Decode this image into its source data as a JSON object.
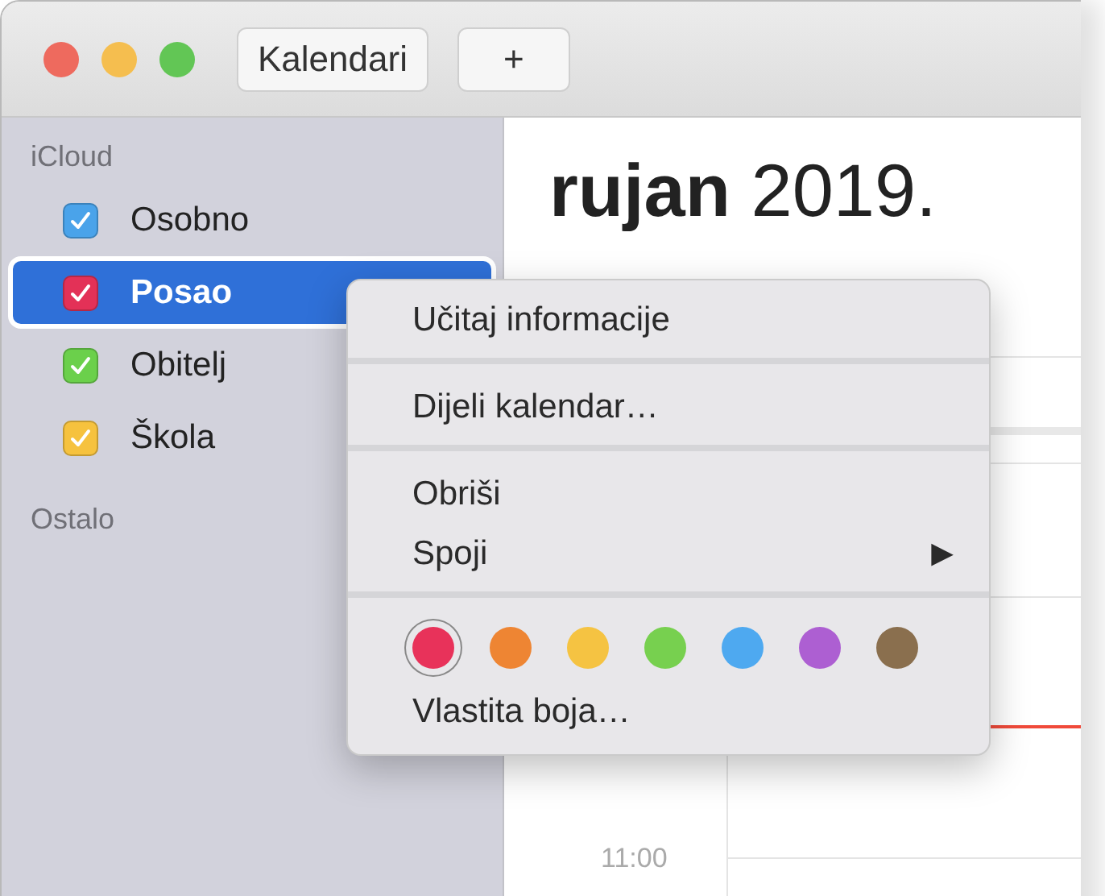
{
  "toolbar": {
    "buttons": [
      "Kalendari",
      "+"
    ]
  },
  "sidebar": {
    "groups": [
      {
        "title": "iCloud",
        "calendars": [
          {
            "name": "Osobno",
            "checked": true,
            "selected": false,
            "color": "#4aa3ea"
          },
          {
            "name": "Posao",
            "checked": true,
            "selected": true,
            "color": "#e33157"
          },
          {
            "name": "Obitelj",
            "checked": true,
            "selected": false,
            "color": "#6bd04b"
          },
          {
            "name": "Škola",
            "checked": true,
            "selected": false,
            "color": "#f6c23e"
          }
        ]
      },
      {
        "title": "Ostalo"
      }
    ]
  },
  "main": {
    "title": "**rujan** 2019.",
    "time_label": "11:00"
  },
  "context_menu": {
    "entries": [
      {
        "kind": "item",
        "label": "Učitaj informacije"
      },
      {
        "kind": "separator"
      },
      {
        "kind": "item",
        "label": "Dijeli kalendar…"
      },
      {
        "kind": "separator"
      },
      {
        "kind": "item",
        "label": "Obriši"
      },
      {
        "kind": "item",
        "label": "Spoji",
        "arrow": "▶"
      },
      {
        "kind": "separator"
      },
      {
        "kind": "colors",
        "swatches": [
          {
            "color": "#e8325a",
            "selected": true
          },
          {
            "color": "#ee8533",
            "selected": false
          },
          {
            "color": "#f5c342",
            "selected": false
          },
          {
            "color": "#77d04f",
            "selected": false
          },
          {
            "color": "#4ea9f0",
            "selected": false
          },
          {
            "color": "#ad5fd2",
            "selected": false
          },
          {
            "color": "#8a6f4e",
            "selected": false
          }
        ]
      },
      {
        "kind": "item",
        "label": "Vlastita boja…"
      }
    ]
  }
}
